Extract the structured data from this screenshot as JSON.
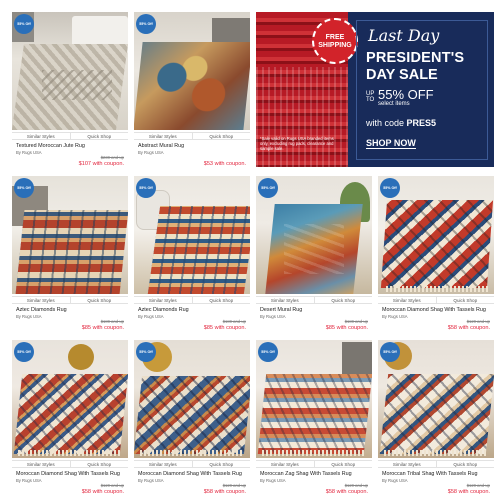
{
  "colors": {
    "badge": "#2a6fb9",
    "sale_price": "#e2253d",
    "banner_bg": "#182b5a",
    "banner_red": "#d2232a"
  },
  "common": {
    "similar": "Similar Styles",
    "quick": "Quick Shop",
    "brand": "By Rugs USA"
  },
  "products": [
    {
      "badge": "55% Off",
      "title": "Textured Moroccan Jute Rug",
      "was": "$239 and up",
      "price": "$107 with coupon."
    },
    {
      "badge": "55% Off",
      "title": "Abstract Mural Rug",
      "was": "",
      "price": "$53 with coupon."
    },
    {
      "badge": "55% Off",
      "title": "Aztec Diamonds Rug",
      "was": "$189 and up",
      "price": "$85 with coupon."
    },
    {
      "badge": "55% Off",
      "title": "Aztec Diamonds Rug",
      "was": "$189 and up",
      "price": "$85 with coupon."
    },
    {
      "badge": "55% Off",
      "title": "Desert Mural Rug",
      "was": "$189 and up",
      "price": "$85 with coupon."
    },
    {
      "badge": "55% Off",
      "title": "Moroccan Diamond Shag With Tassels Rug",
      "was": "$129 and up",
      "price": "$58 with coupon."
    },
    {
      "badge": "55% Off",
      "title": "Moroccan Diamond Shag With Tassels Rug",
      "was": "$129 and up",
      "price": "$58 with coupon."
    },
    {
      "badge": "55% Off",
      "title": "Moroccan Diamond Shag With Tassels Rug",
      "was": "$129 and up",
      "price": "$58 with coupon."
    },
    {
      "badge": "55% Off",
      "title": "Moroccan Zag Shag With Tassels Rug",
      "was": "$129 and up",
      "price": "$58 with coupon."
    },
    {
      "badge": "55% Off",
      "title": "Moroccan Tribal Shag With Tassels Rug",
      "was": "$129 and up",
      "price": "$58 with coupon."
    }
  ],
  "banner": {
    "stamp_line1": "FREE",
    "stamp_line2": "SHIPPING",
    "fine_print": "*Sale valid on Rugs USA branded items only, excluding rug pads, clearance and sample sale.",
    "last_day": "Last Day",
    "line1": "PRESIDENT'S",
    "line2": "DAY SALE",
    "up_to": "UP TO",
    "percent": "55% OFF",
    "select": "select items",
    "code_prefix": "with code ",
    "code": "PRES5",
    "cta": "SHOP NOW"
  }
}
